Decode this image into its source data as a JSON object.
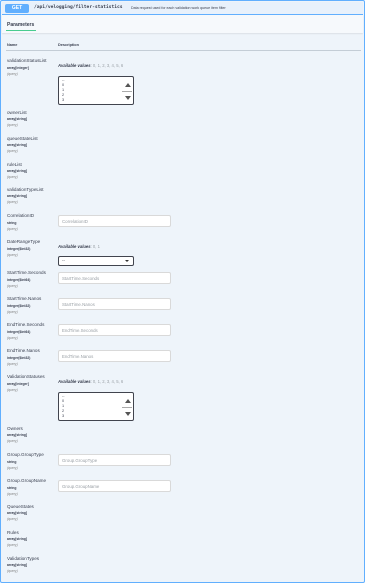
{
  "summary": {
    "method": "GET",
    "path": "/api/velogging/filter-statistics",
    "description": "Data request used for each validation work queue item filter"
  },
  "tabs": {
    "parameters": "Parameters"
  },
  "columns": {
    "name": "Name",
    "description": "Description"
  },
  "params": [
    {
      "name": "validationStatusList",
      "type": "array[integer]",
      "in": "(query)",
      "available_label": "Available values",
      "available_values": ": 0, 1, 2, 3, 4, 5, 6",
      "options": [
        "--",
        "0",
        "1",
        "2",
        "3"
      ]
    },
    {
      "name": "ownerList",
      "type": "array[string]",
      "in": "(query)"
    },
    {
      "name": "queueStateList",
      "type": "array[string]",
      "in": "(query)"
    },
    {
      "name": "ruleList",
      "type": "array[string]",
      "in": "(query)"
    },
    {
      "name": "validationTypeList",
      "type": "array[string]",
      "in": "(query)"
    },
    {
      "name": "CorrelationID",
      "type": "string",
      "in": "(query)",
      "placeholder": "CorrelationID"
    },
    {
      "name": "DateRangeType",
      "type": "integer($int32)",
      "in": "(query)",
      "available_label": "Available values",
      "available_values": ": 0, 1",
      "selected": "--"
    },
    {
      "name": "StartTime.Seconds",
      "type": "integer($int64)",
      "in": "(query)",
      "placeholder": "StartTime.Seconds"
    },
    {
      "name": "StartTime.Nanos",
      "type": "integer($int32)",
      "in": "(query)",
      "placeholder": "StartTime.Nanos"
    },
    {
      "name": "EndTime.Seconds",
      "type": "integer($int64)",
      "in": "(query)",
      "placeholder": "EndTime.Seconds"
    },
    {
      "name": "EndTime.Nanos",
      "type": "integer($int32)",
      "in": "(query)",
      "placeholder": "EndTime.Nanos"
    },
    {
      "name": "ValidationStatuses",
      "type": "array[integer]",
      "in": "(query)",
      "available_label": "Available values",
      "available_values": ": 0, 1, 2, 3, 4, 5, 6",
      "options": [
        "--",
        "0",
        "1",
        "2",
        "3"
      ]
    },
    {
      "name": "Owners",
      "type": "array[string]",
      "in": "(query)"
    },
    {
      "name": "Group.GroupType",
      "type": "string",
      "in": "(query)",
      "placeholder": "Group.GroupType"
    },
    {
      "name": "Group.GroupName",
      "type": "string",
      "in": "(query)",
      "placeholder": "Group.GroupName"
    },
    {
      "name": "QueueStates",
      "type": "array[string]",
      "in": "(query)"
    },
    {
      "name": "Rules",
      "type": "array[string]",
      "in": "(query)"
    },
    {
      "name": "ValidationTypes",
      "type": "array[string]",
      "in": "(query)"
    }
  ]
}
